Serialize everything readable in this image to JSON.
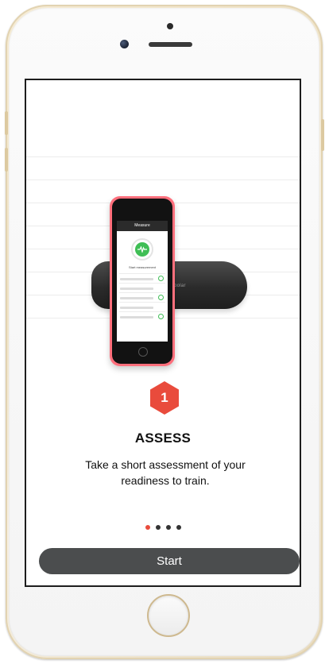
{
  "onboarding": {
    "step_number": "1",
    "step_title": "ASSESS",
    "step_description": "Take a short assessment of your readiness to train.",
    "page_count": 4,
    "active_page": 1,
    "start_label": "Start",
    "accent_color": "#e94b3c"
  },
  "illustration": {
    "screen_title": "Measure",
    "measure_label": "Start measurement",
    "status_color": "#3fbe55",
    "device_color": "#ff6f7c",
    "strap_brand": "polar"
  },
  "icons": {
    "step_badge": "hexagon-icon",
    "heart_rate": "heart-rate-icon"
  }
}
